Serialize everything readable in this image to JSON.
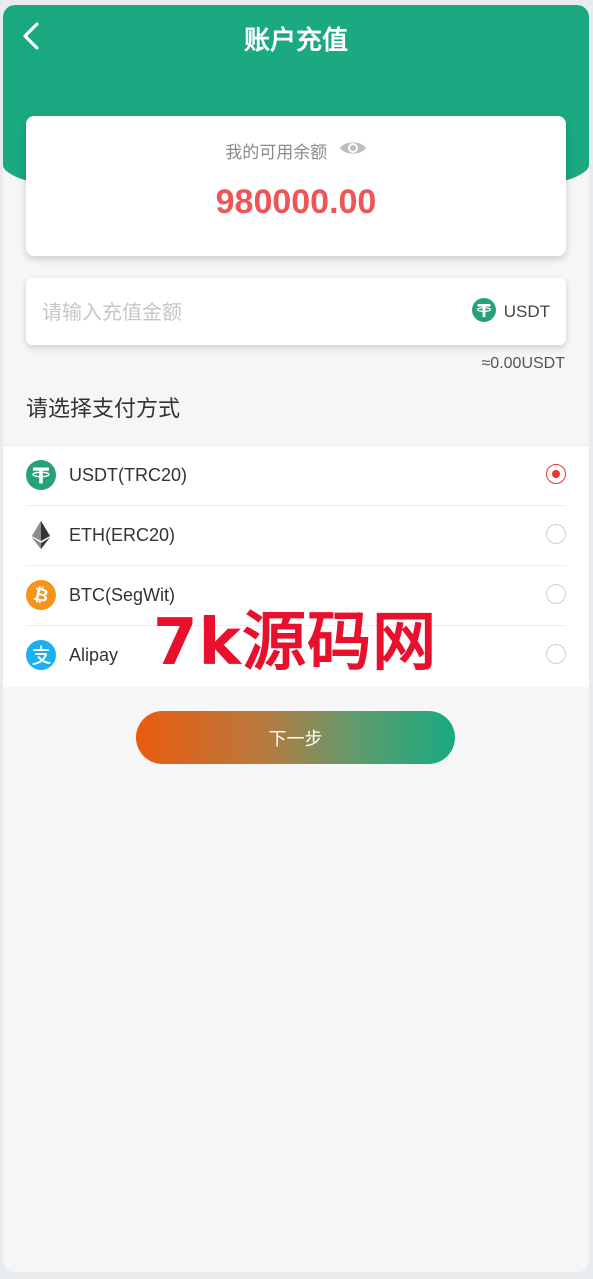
{
  "header": {
    "title": "账户充值",
    "back_icon": "chevron-left-icon",
    "color": "#1aa981"
  },
  "balance": {
    "label": "我的可用余额",
    "amount": "980000.00",
    "amount_color": "#f05454",
    "toggle_icon": "eye-icon"
  },
  "recharge": {
    "placeholder": "请输入充值金额",
    "value": "",
    "currency": "USDT",
    "currency_icon": "tether-icon",
    "approx": "≈0.00USDT"
  },
  "payment": {
    "title": "请选择支付方式",
    "methods": [
      {
        "label": "USDT(TRC20)",
        "icon": "tether-icon",
        "selected": true
      },
      {
        "label": "ETH(ERC20)",
        "icon": "ethereum-icon",
        "selected": false
      },
      {
        "label": "BTC(SegWit)",
        "icon": "bitcoin-icon",
        "selected": false
      },
      {
        "label": "Alipay",
        "icon": "alipay-icon",
        "selected": false
      }
    ]
  },
  "watermark": "7k源码网",
  "next_button": {
    "label": "下一步"
  }
}
